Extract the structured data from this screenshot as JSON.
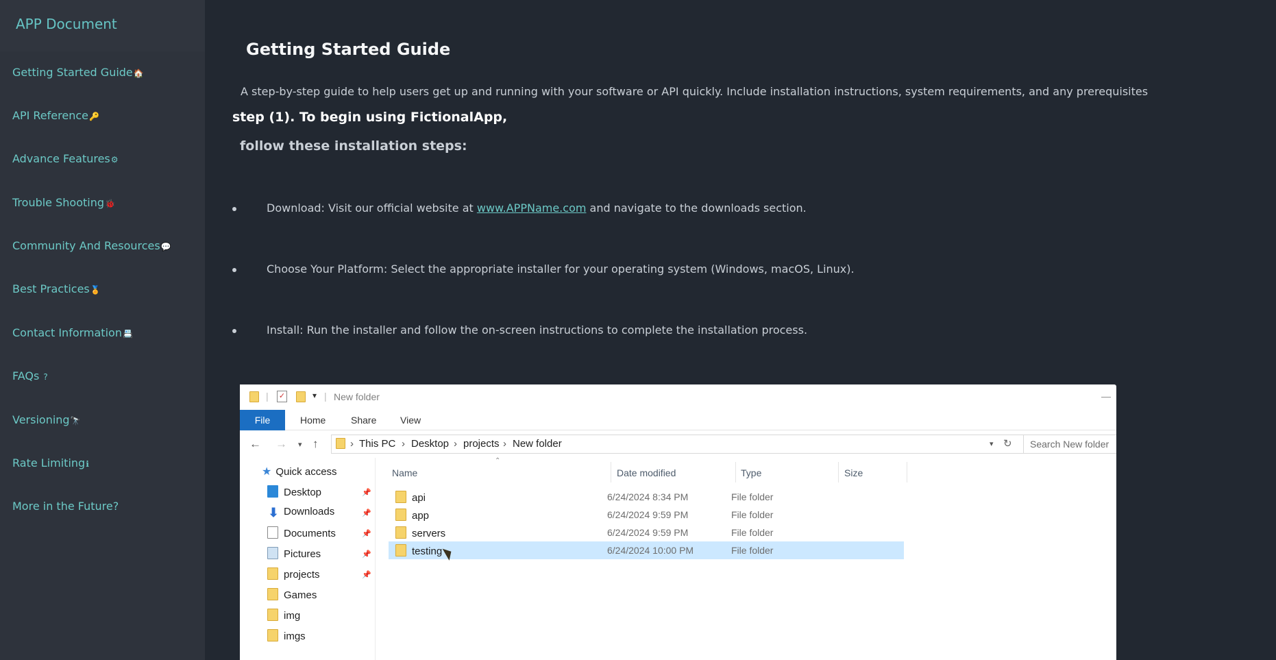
{
  "app": {
    "brand": "APP Document"
  },
  "sidebar": {
    "items": [
      {
        "label": "Getting Started Guide",
        "icon": "house-icon",
        "glyph": "🏠"
      },
      {
        "label": "API Reference",
        "icon": "key-icon",
        "glyph": "🔑"
      },
      {
        "label": "Advance Features",
        "icon": "gear-icon",
        "glyph": "⚙"
      },
      {
        "label": "Trouble Shooting",
        "icon": "bug-icon",
        "glyph": "🐞"
      },
      {
        "label": "Community And Resources",
        "icon": "comments-icon",
        "glyph": "💬"
      },
      {
        "label": "Best Practices",
        "icon": "medal-icon",
        "glyph": "🏅"
      },
      {
        "label": "Contact Information",
        "icon": "contact-card-icon",
        "glyph": "📇"
      },
      {
        "label": "FAQs",
        "icon": "question-icon",
        "glyph": "?"
      },
      {
        "label": "Versioning",
        "icon": "binoculars-icon",
        "glyph": "🔭"
      },
      {
        "label": "Rate Limiting",
        "icon": "info-icon",
        "glyph": "ℹ"
      },
      {
        "label": "More in the Future?",
        "icon": "",
        "glyph": ""
      }
    ]
  },
  "main": {
    "title": "Getting Started Guide",
    "intro": "A step-by-step guide to help users get up and running with your software or API quickly. Include installation instructions, system requirements, and any prerequisites",
    "step_heading": "step (1). To begin using FictionalApp,",
    "step_sub": "follow these installation steps:",
    "bullets": [
      {
        "before": "Download: Visit our official website at ",
        "link": "www.APPName.com",
        "after": " and navigate to the downloads section."
      },
      {
        "text": "Choose Your Platform: Select the appropriate installer for your operating system (Windows, macOS, Linux)."
      },
      {
        "text": "Install: Run the installer and follow the on-screen instructions to complete the installation process."
      }
    ]
  },
  "explorer": {
    "window_title": "New folder",
    "ribbon_tabs": [
      "File",
      "Home",
      "Share",
      "View"
    ],
    "breadcrumb": [
      "This PC",
      "Desktop",
      "projects",
      "New folder"
    ],
    "search_placeholder": "Search New folder",
    "quick_access": "Quick access",
    "nav_items": [
      {
        "label": "Desktop",
        "icon": "desktop-icon",
        "pinned": true
      },
      {
        "label": "Downloads",
        "icon": "downloads-icon",
        "pinned": true
      },
      {
        "label": "Documents",
        "icon": "documents-icon",
        "pinned": true
      },
      {
        "label": "Pictures",
        "icon": "pictures-icon",
        "pinned": true
      },
      {
        "label": "projects",
        "icon": "folder-icon",
        "pinned": true
      },
      {
        "label": "Games",
        "icon": "folder-icon",
        "pinned": false
      },
      {
        "label": "img",
        "icon": "folder-icon",
        "pinned": false
      },
      {
        "label": "imgs",
        "icon": "folder-icon",
        "pinned": false
      }
    ],
    "columns": [
      "Name",
      "Date modified",
      "Type",
      "Size"
    ],
    "files": [
      {
        "name": "api",
        "date": "6/24/2024 8:34 PM",
        "type": "File folder",
        "selected": false
      },
      {
        "name": "app",
        "date": "6/24/2024 9:59 PM",
        "type": "File folder",
        "selected": false
      },
      {
        "name": "servers",
        "date": "6/24/2024 9:59 PM",
        "type": "File folder",
        "selected": false
      },
      {
        "name": "testing",
        "date": "6/24/2024 10:00 PM",
        "type": "File folder",
        "selected": true
      }
    ]
  },
  "colors": {
    "background": "#222831",
    "sidebar": "#2e333c",
    "accent": "#6cc9c6",
    "file_tab": "#1b6ec2",
    "selection": "#cce8ff"
  }
}
